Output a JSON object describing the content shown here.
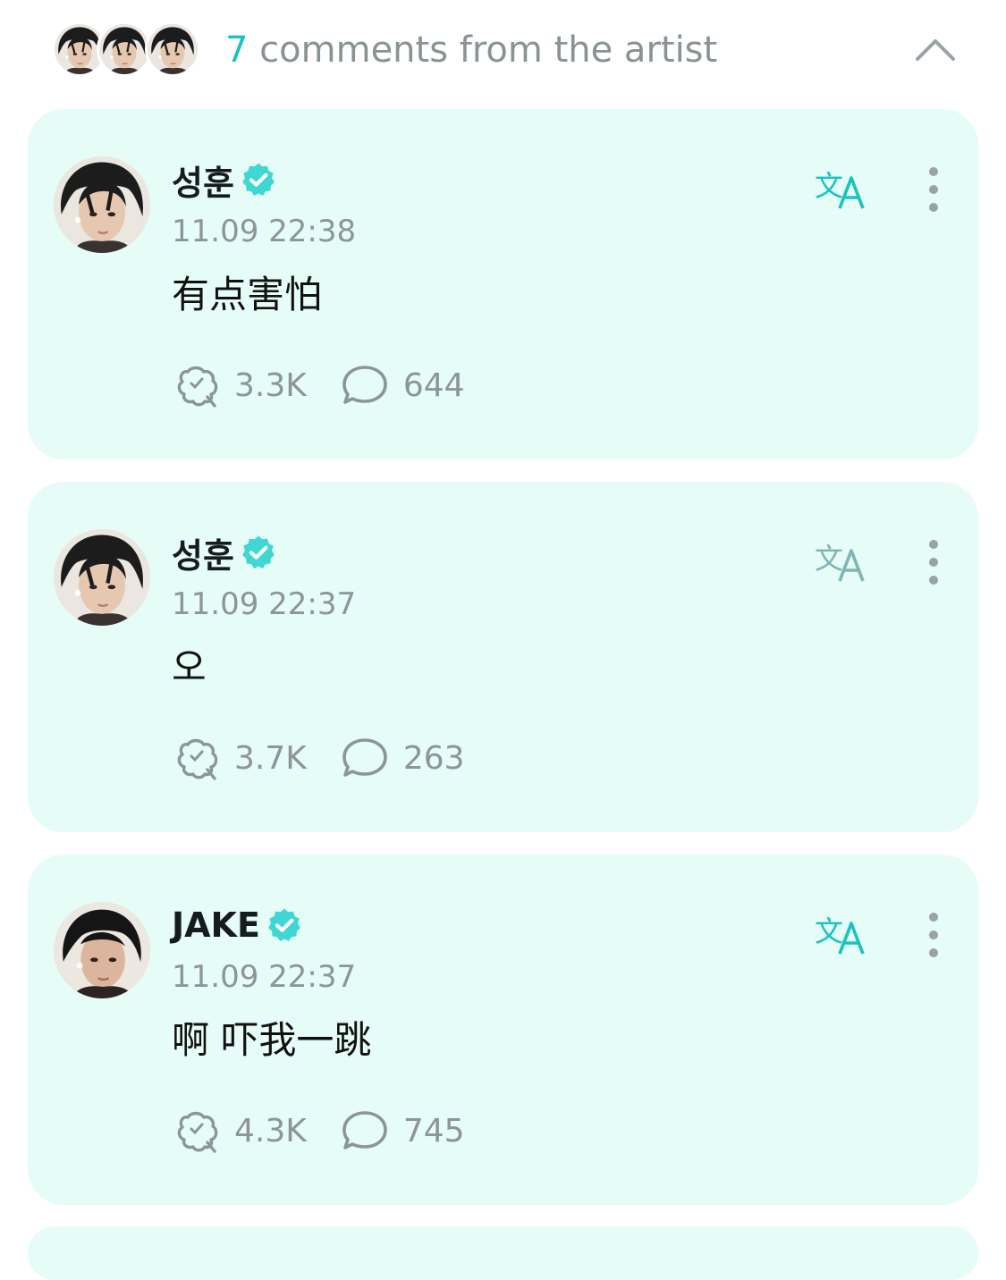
{
  "header": {
    "count": "7",
    "label": "comments from the artist",
    "collapse_icon": "chevron-up-icon",
    "artist_avatars": [
      "artist-avatar-1",
      "artist-avatar-2",
      "artist-avatar-3"
    ]
  },
  "colors": {
    "accent": "#19c3c0",
    "card_bg": "#e6fcf6",
    "muted": "#8d9595",
    "translate_active": "#19c3c0",
    "translate_inactive": "#7fb5b3"
  },
  "comments": [
    {
      "author": "성훈",
      "verified_icon": "verified-badge-icon",
      "timestamp": "11.09 22:38",
      "text": "有点害怕",
      "likes": "3.3K",
      "replies": "644",
      "translate_icon": "translate-icon",
      "translate_active": true
    },
    {
      "author": "성훈",
      "verified_icon": "verified-badge-icon",
      "timestamp": "11.09 22:37",
      "text": "오",
      "likes": "3.7K",
      "replies": "263",
      "translate_icon": "translate-icon",
      "translate_active": false
    },
    {
      "author": "JAKE",
      "verified_icon": "verified-badge-icon",
      "timestamp": "11.09 22:37",
      "text": "啊 吓我一跳",
      "likes": "4.3K",
      "replies": "745",
      "translate_icon": "translate-icon",
      "translate_active": true
    }
  ]
}
